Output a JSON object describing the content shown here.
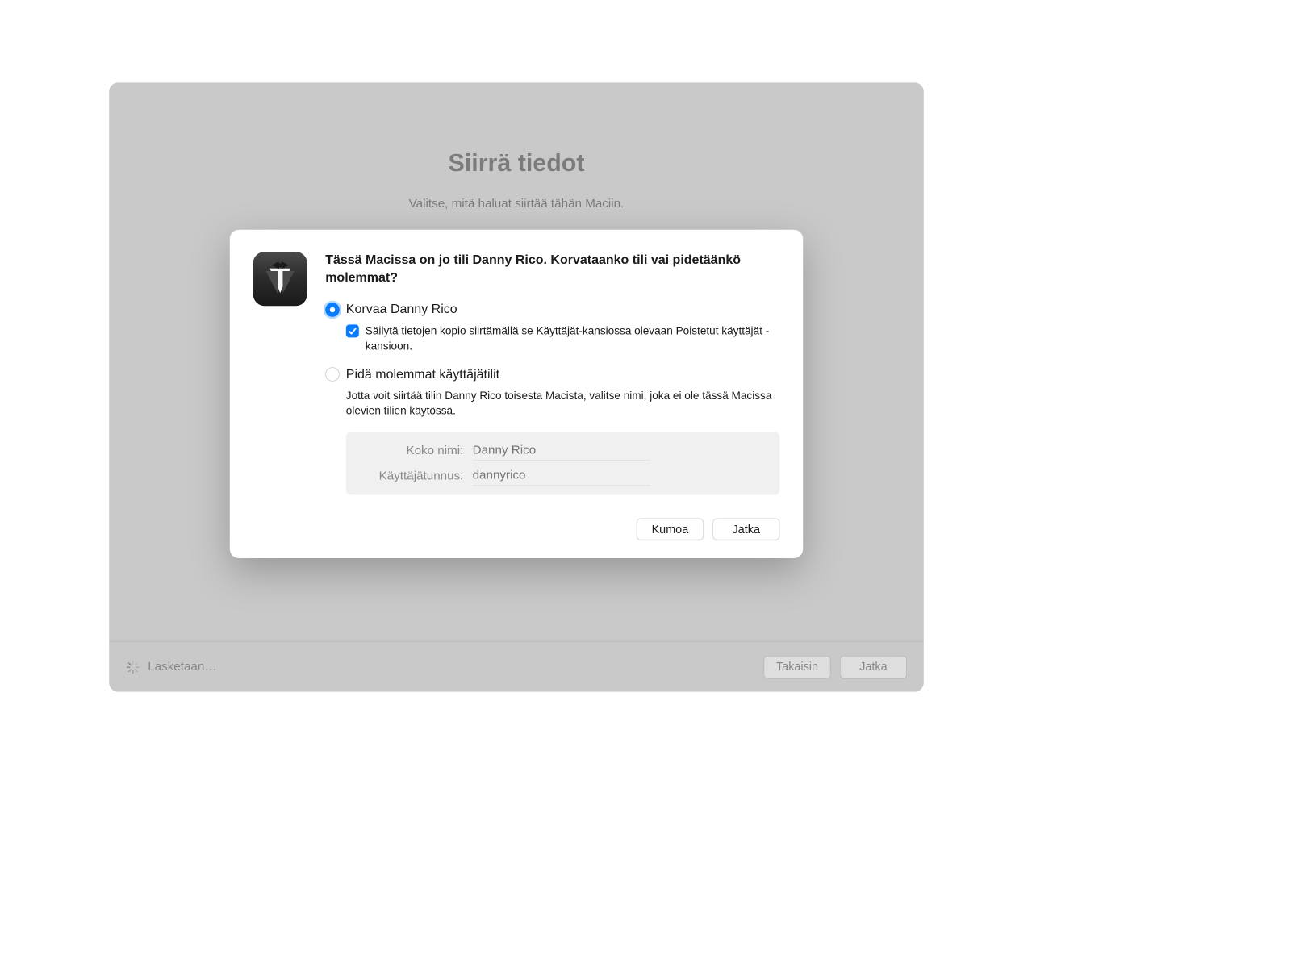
{
  "background": {
    "title": "Siirrä tiedot",
    "subtitle": "Valitse, mitä haluat siirtää tähän Maciin."
  },
  "dialog": {
    "heading": "Tässä Macissa on jo tili Danny Rico. Korvataanko tili vai pidetäänkö molemmat?",
    "option_replace": "Korvaa Danny Rico",
    "option_replace_sub": "Säilytä tietojen kopio siirtämällä se Käyttäjät-kansiossa olevaan Poistetut käyttäjät -kansioon.",
    "option_keep": "Pidä molemmat käyttäjätilit",
    "info_text": "Jotta voit siirtää tilin Danny Rico toisesta Macista, valitse nimi, joka ei ole tässä Macissa olevien tilien käytössä.",
    "form": {
      "fullname_label": "Koko nimi:",
      "fullname_placeholder": "Danny Rico",
      "username_label": "Käyttäjätunnus:",
      "username_placeholder": "dannyrico"
    },
    "buttons": {
      "cancel": "Kumoa",
      "continue": "Jatka"
    }
  },
  "footer": {
    "status": "Lasketaan…",
    "back": "Takaisin",
    "continue": "Jatka"
  }
}
